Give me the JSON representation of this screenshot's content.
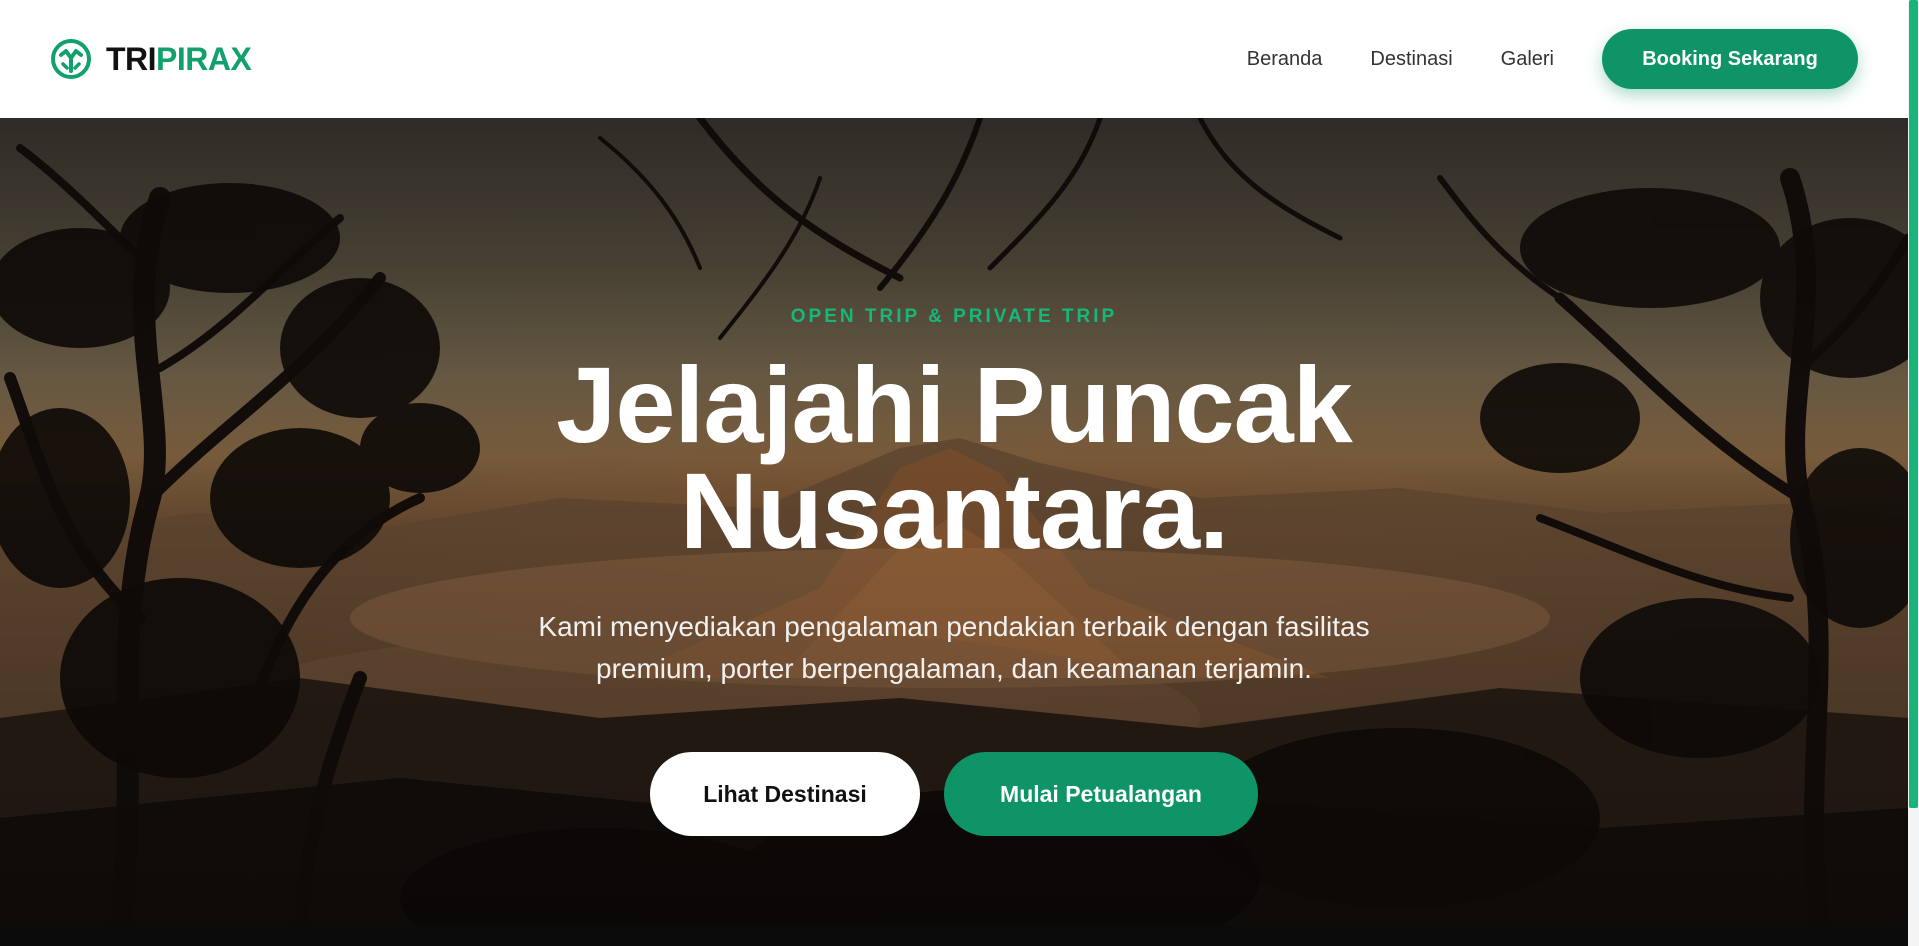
{
  "brand": {
    "name_part1": "TRI",
    "name_part2": "PIRAX",
    "icon": "mountain-logo-icon",
    "accent": "#12a06b"
  },
  "nav": {
    "links": [
      "Beranda",
      "Destinasi",
      "Galeri"
    ],
    "cta_label": "Booking Sekarang"
  },
  "hero": {
    "eyebrow": "OPEN TRIP & PRIVATE TRIP",
    "title_line1": "Jelajahi Puncak",
    "title_line2": "Nusantara.",
    "description_line1": "Kami menyediakan pengalaman pendakian terbaik dengan fasilitas",
    "description_line2": "premium, porter berpengalaman, dan keamanan terjamin.",
    "secondary_button": "Lihat Destinasi",
    "primary_button": "Mulai Petualangan",
    "background": "mountain-sunrise-with-tree-silhouettes"
  },
  "colors": {
    "primary": "#0e9467",
    "eyebrow": "#16b879",
    "scrollbar": "#18b47a"
  }
}
